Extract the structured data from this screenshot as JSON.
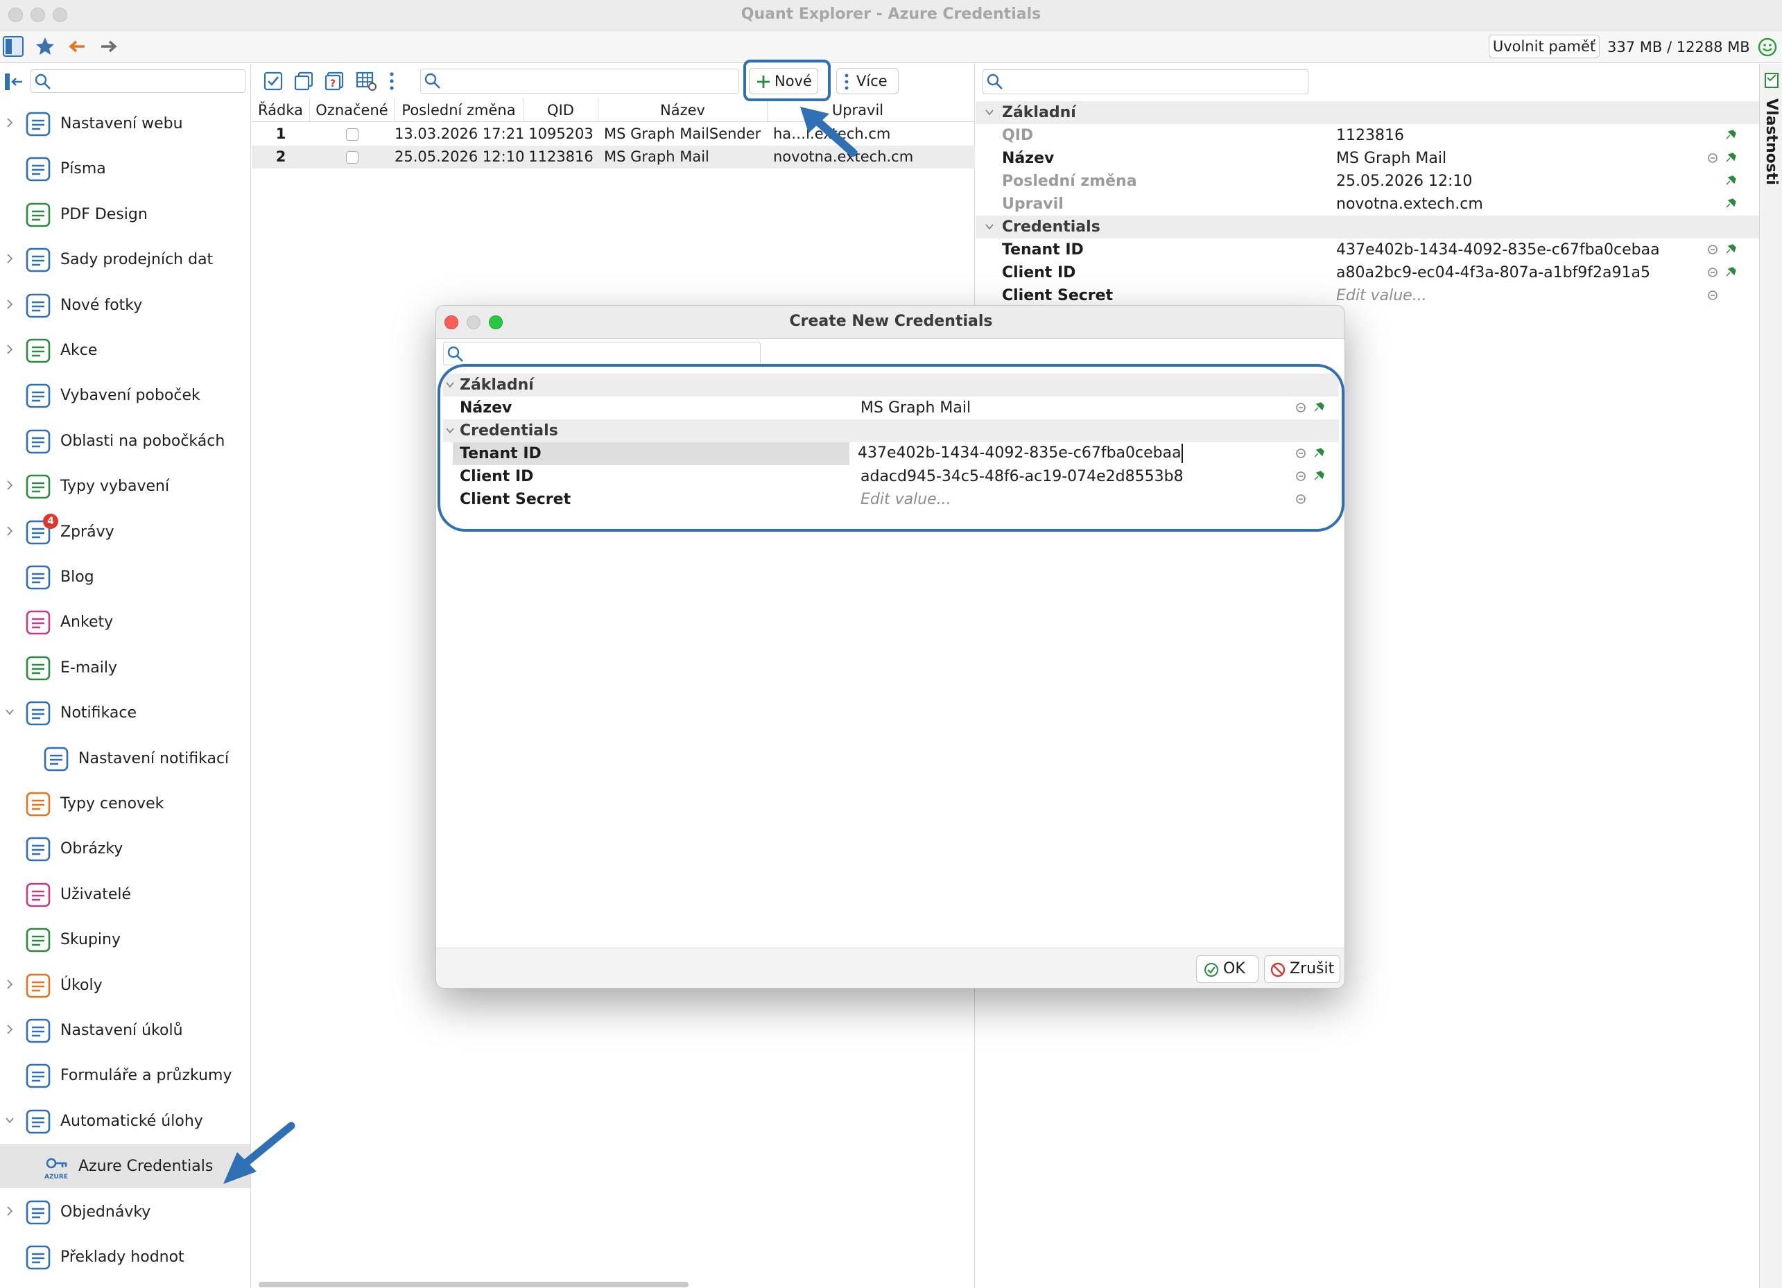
{
  "window": {
    "title": "Quant Explorer - Azure Credentials"
  },
  "toolbar": {
    "free_memory_label": "Uvolnit paměť",
    "memory_text": "337 MB / 12288 MB"
  },
  "sidebar": {
    "search_placeholder": "",
    "items": [
      {
        "label": "Nastavení webu",
        "icon": "globe-gear-icon"
      },
      {
        "label": "Písma",
        "icon": "font-icon"
      },
      {
        "label": "PDF Design",
        "icon": "pdf-design-icon"
      },
      {
        "label": "Sady prodejních dat",
        "icon": "sales-data-icon"
      },
      {
        "label": "Nové fotky",
        "icon": "camera-icon"
      },
      {
        "label": "Akce",
        "icon": "clock-icon"
      },
      {
        "label": "Vybavení poboček",
        "icon": "branch-equipment-icon"
      },
      {
        "label": "Oblasti na pobočkách",
        "icon": "branch-areas-icon"
      },
      {
        "label": "Typy vybavení",
        "icon": "equipment-types-icon"
      },
      {
        "label": "Zprávy",
        "icon": "messages-icon",
        "badge": "4"
      },
      {
        "label": "Blog",
        "icon": "blog-icon"
      },
      {
        "label": "Ankety",
        "icon": "poll-icon"
      },
      {
        "label": "E-maily",
        "icon": "envelope-icon"
      },
      {
        "label": "Notifikace",
        "icon": "bell-icon"
      },
      {
        "label": "Nastavení notifikací",
        "icon": "bell-gear-icon"
      },
      {
        "label": "Typy cenovek",
        "icon": "price-tag-icon"
      },
      {
        "label": "Obrázky",
        "icon": "image-icon"
      },
      {
        "label": "Uživatelé",
        "icon": "user-icon"
      },
      {
        "label": "Skupiny",
        "icon": "group-icon"
      },
      {
        "label": "Úkoly",
        "icon": "task-check-icon"
      },
      {
        "label": "Nastavení úkolů",
        "icon": "task-settings-icon"
      },
      {
        "label": "Formuláře a průzkumy",
        "icon": "form-icon"
      },
      {
        "label": "Automatické úlohy",
        "icon": "automatic-tasks-icon"
      },
      {
        "label": "Azure Credentials",
        "icon": "azure-key-icon",
        "icon_text": "AZURE"
      },
      {
        "label": "Objednávky",
        "icon": "orders-icon"
      },
      {
        "label": "Překlady hodnot",
        "icon": "translation-icon"
      }
    ]
  },
  "list": {
    "new_button_label": "Nové",
    "more_button_label": "Více",
    "columns": [
      "Řádka",
      "Označené",
      "Poslední změna",
      "QID",
      "Název",
      "Upravil"
    ],
    "rows": [
      {
        "row": "1",
        "changed": "13.03.2026 17:21",
        "qid": "1095203",
        "name": "MS Graph MailSender",
        "editor": "ha…l.extech.cm"
      },
      {
        "row": "2",
        "changed": "25.05.2026 12:10",
        "qid": "1123816",
        "name": "MS Graph Mail",
        "editor": "novotna.extech.cm"
      }
    ]
  },
  "properties": {
    "tab_label": "Vlastnosti",
    "groups": {
      "basic": "Základní",
      "credentials": "Credentials"
    },
    "fields": {
      "qid": {
        "label": "QID",
        "value": "1123816"
      },
      "name": {
        "label": "Název",
        "value": "MS Graph Mail"
      },
      "last_change": {
        "label": "Poslední změna",
        "value": "25.05.2026 12:10"
      },
      "edited_by": {
        "label": "Upravil",
        "value": "novotna.extech.cm"
      },
      "tenant_id": {
        "label": "Tenant ID",
        "value": "437e402b-1434-4092-835e-c67fba0cebaa"
      },
      "client_id": {
        "label": "Client ID",
        "value": "a80a2bc9-ec04-4f3a-807a-a1bf9f2a91a5"
      },
      "client_secret": {
        "label": "Client Secret",
        "placeholder": "Edit value..."
      }
    }
  },
  "dialog": {
    "title": "Create New Credentials",
    "groups": {
      "basic": "Základní",
      "credentials": "Credentials"
    },
    "fields": {
      "name": {
        "label": "Název",
        "value": "MS Graph Mail"
      },
      "tenant_id": {
        "label": "Tenant ID",
        "value": "437e402b-1434-4092-835e-c67fba0cebaa"
      },
      "client_id": {
        "label": "Client ID",
        "value": "adacd945-34c5-48f6-ac19-074e2d8553b8"
      },
      "client_secret": {
        "label": "Client Secret",
        "placeholder": "Edit value..."
      }
    },
    "ok_label": "OK",
    "cancel_label": "Zrušit"
  },
  "colors": {
    "accent": "#2f6fb3",
    "selection": "#e4e4e4",
    "badge": "#e0352b"
  }
}
